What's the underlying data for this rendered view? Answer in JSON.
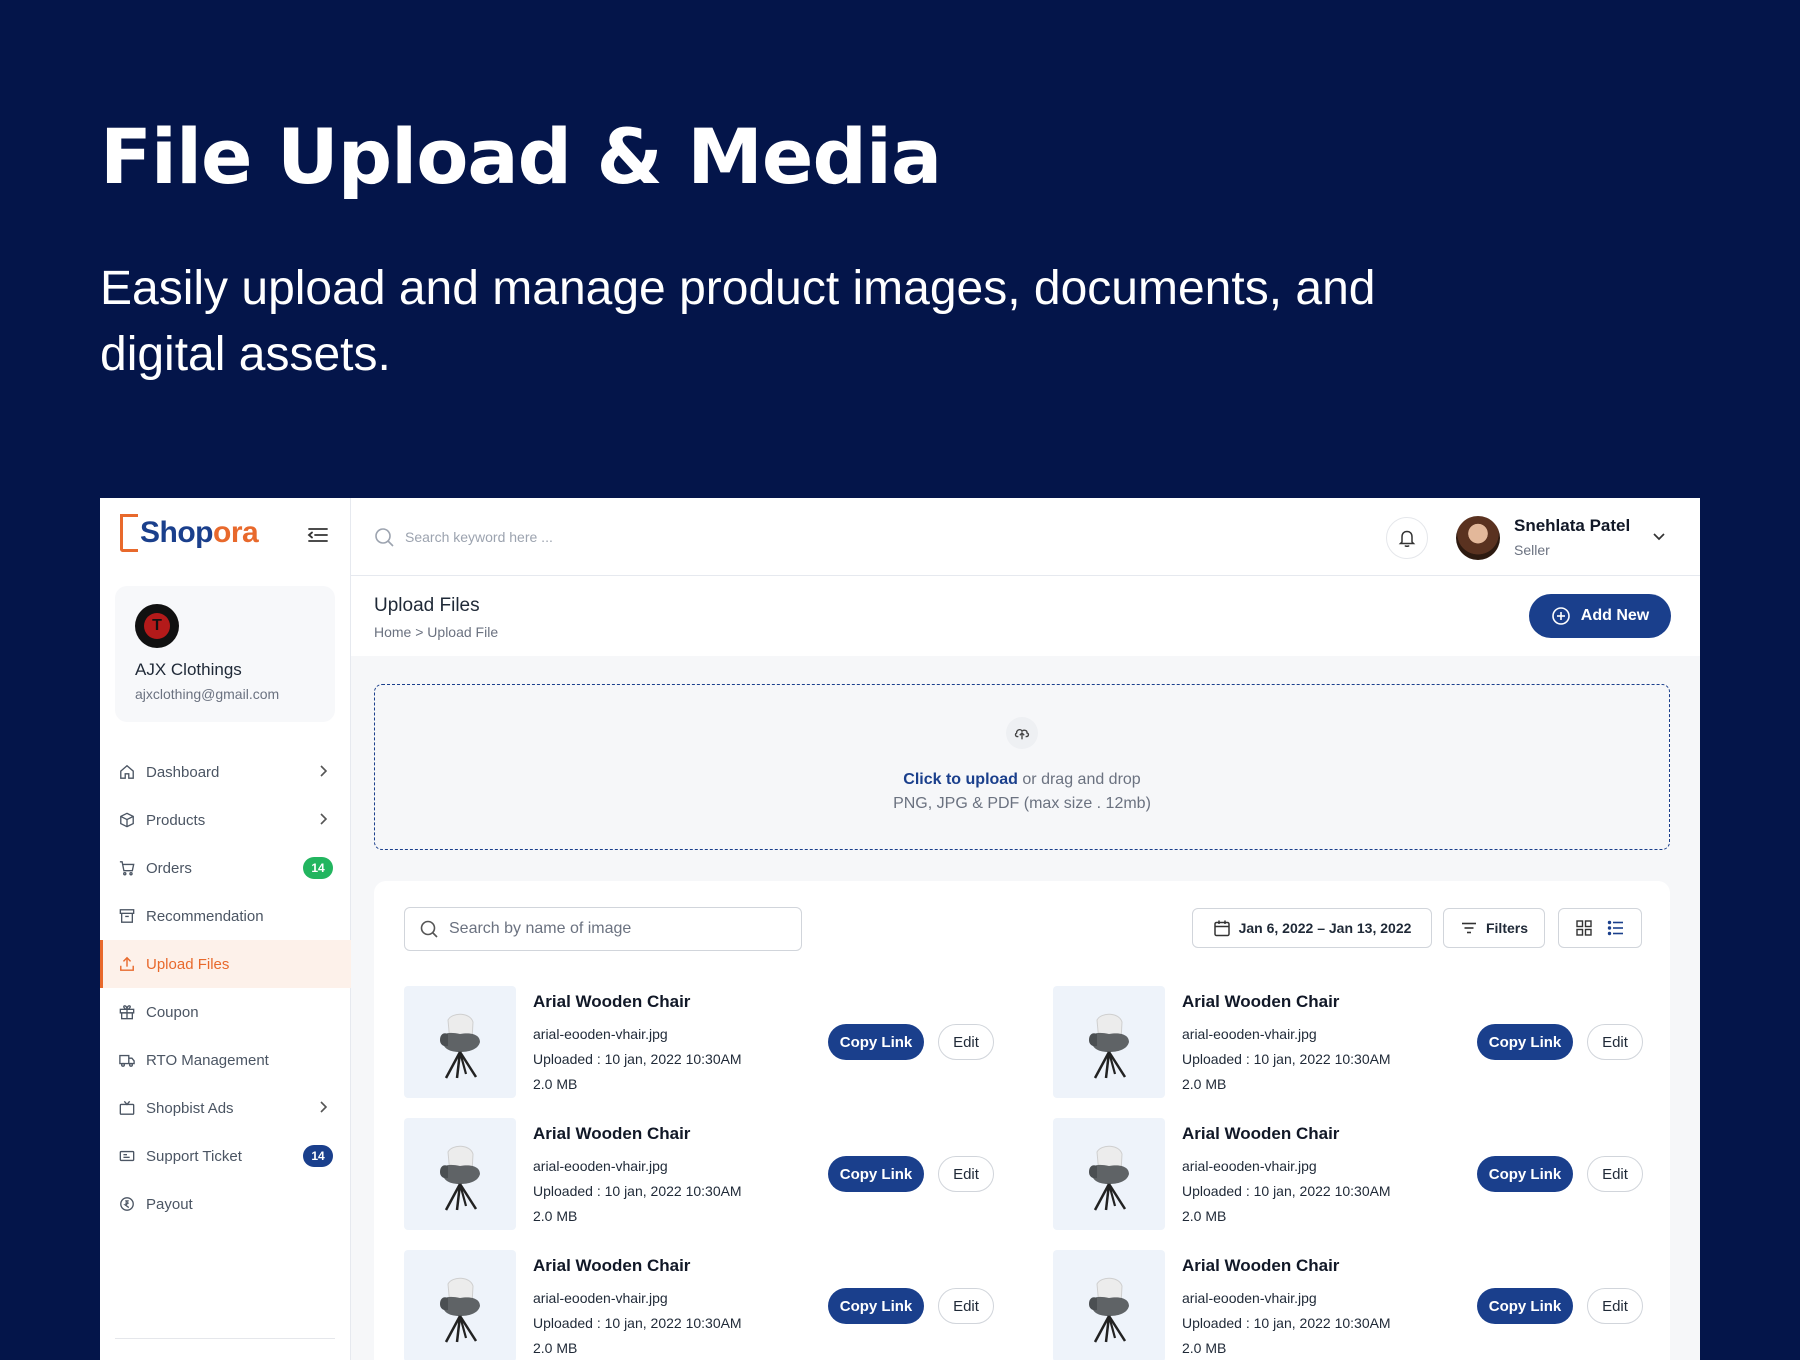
{
  "hero": {
    "title": "File Upload & Media",
    "subtitle": "Easily upload and manage product images, documents, and digital assets."
  },
  "brand": {
    "name_part1": "Shop",
    "name_part2": "ora"
  },
  "store": {
    "name": "AJX Clothings",
    "email": "ajxclothing@gmail.com"
  },
  "sidebar": {
    "items": [
      {
        "label": "Dashboard",
        "icon": "home-icon",
        "chevron": true
      },
      {
        "label": "Products",
        "icon": "box-icon",
        "chevron": true
      },
      {
        "label": "Orders",
        "icon": "cart-icon",
        "badge": "14",
        "badge_color": "#22b55f"
      },
      {
        "label": "Recommendation",
        "icon": "archive-icon"
      },
      {
        "label": "Upload Files",
        "icon": "upload-icon",
        "active": true
      },
      {
        "label": "Coupon",
        "icon": "gift-icon"
      },
      {
        "label": "RTO Management",
        "icon": "truck-icon"
      },
      {
        "label": "Shopbist Ads",
        "icon": "tv-icon",
        "chevron": true
      },
      {
        "label": "Support Ticket",
        "icon": "ticket-icon",
        "badge": "14",
        "badge_color": "#1a3f8c"
      },
      {
        "label": "Payout",
        "icon": "coin-icon"
      }
    ]
  },
  "topbar": {
    "search_placeholder": "Search keyword here ...",
    "user_name": "Snehlata Patel",
    "user_role": "Seller"
  },
  "page": {
    "title": "Upload Files",
    "breadcrumb": "Home > Upload File",
    "add_button": "Add New"
  },
  "dropzone": {
    "link_text": "Click to upload",
    "rest_text": " or drag and drop",
    "formats": "PNG, JPG & PDF (max size . 12mb)"
  },
  "toolbar": {
    "search_placeholder": "Search by name of image",
    "date_range": "Jan 6, 2022 – Jan 13, 2022",
    "filters_label": "Filters"
  },
  "files": [
    {
      "title": "Arial Wooden Chair",
      "filename": "arial-eooden-vhair.jpg",
      "uploaded": "Uploaded : 10 jan, 2022 10:30AM",
      "size": "2.0 MB",
      "copy_label": "Copy Link",
      "edit_label": "Edit"
    },
    {
      "title": "Arial Wooden Chair",
      "filename": "arial-eooden-vhair.jpg",
      "uploaded": "Uploaded : 10 jan, 2022 10:30AM",
      "size": "2.0 MB",
      "copy_label": "Copy Link",
      "edit_label": "Edit"
    },
    {
      "title": "Arial Wooden Chair",
      "filename": "arial-eooden-vhair.jpg",
      "uploaded": "Uploaded : 10 jan, 2022 10:30AM",
      "size": "2.0 MB",
      "copy_label": "Copy Link",
      "edit_label": "Edit"
    },
    {
      "title": "Arial Wooden Chair",
      "filename": "arial-eooden-vhair.jpg",
      "uploaded": "Uploaded : 10 jan, 2022 10:30AM",
      "size": "2.0 MB",
      "copy_label": "Copy Link",
      "edit_label": "Edit"
    },
    {
      "title": "Arial Wooden Chair",
      "filename": "arial-eooden-vhair.jpg",
      "uploaded": "Uploaded : 10 jan, 2022 10:30AM",
      "size": "2.0 MB",
      "copy_label": "Copy Link",
      "edit_label": "Edit"
    },
    {
      "title": "Arial Wooden Chair",
      "filename": "arial-eooden-vhair.jpg",
      "uploaded": "Uploaded : 10 jan, 2022 10:30AM",
      "size": "2.0 MB",
      "copy_label": "Copy Link",
      "edit_label": "Edit"
    }
  ],
  "colors": {
    "primary": "#1a3f8c",
    "accent": "#e8692c",
    "background": "#04154a",
    "success": "#22b55f"
  }
}
